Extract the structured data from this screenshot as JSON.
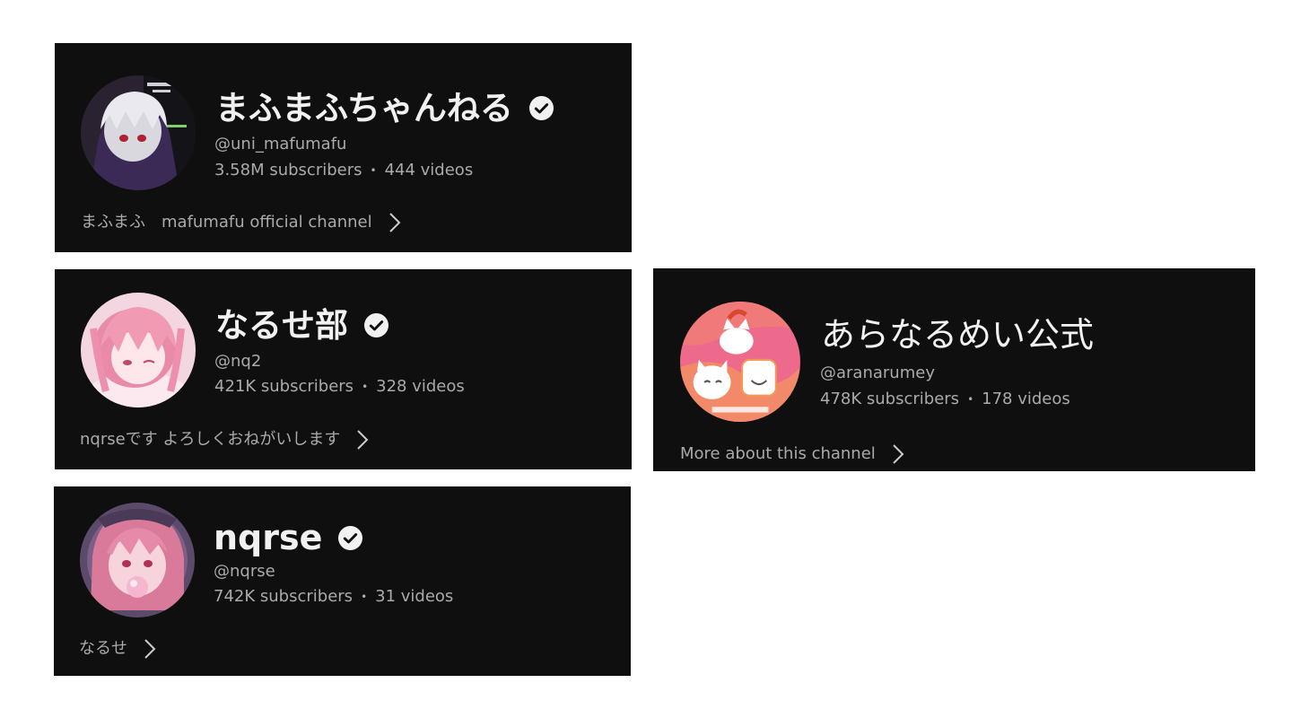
{
  "channels": [
    {
      "title": "まふまふちゃんねる",
      "verified": true,
      "handle": "@uni_mafumafu",
      "subscribers": "3.58M subscribers",
      "videos": "444 videos",
      "separator": "•",
      "description": "まふまふ　mafumafu official channel",
      "avatar_icon": "avatar-image",
      "chevron_icon": "chevron-right-icon"
    },
    {
      "title": "なるせ部",
      "verified": true,
      "handle": "@nq2",
      "subscribers": "421K subscribers",
      "videos": "328 videos",
      "separator": "•",
      "description": "nqrseです よろしくおねがいします",
      "avatar_icon": "avatar-image",
      "chevron_icon": "chevron-right-icon"
    },
    {
      "title": "あらなるめい公式",
      "verified": false,
      "handle": "@aranarumey",
      "subscribers": "478K subscribers",
      "videos": "178 videos",
      "separator": "•",
      "description": "More about this channel",
      "avatar_icon": "avatar-image",
      "chevron_icon": "chevron-right-icon"
    },
    {
      "title": "nqrse",
      "verified": true,
      "handle": "@nqrse",
      "subscribers": "742K subscribers",
      "videos": "31 videos",
      "separator": "•",
      "description": "なるせ",
      "avatar_icon": "avatar-image",
      "chevron_icon": "chevron-right-icon"
    }
  ],
  "colors": {
    "card_bg": "#0f0f0f",
    "title": "#f1f1f1",
    "secondary_text": "#aaaaaa",
    "page_bg": "#ffffff"
  }
}
